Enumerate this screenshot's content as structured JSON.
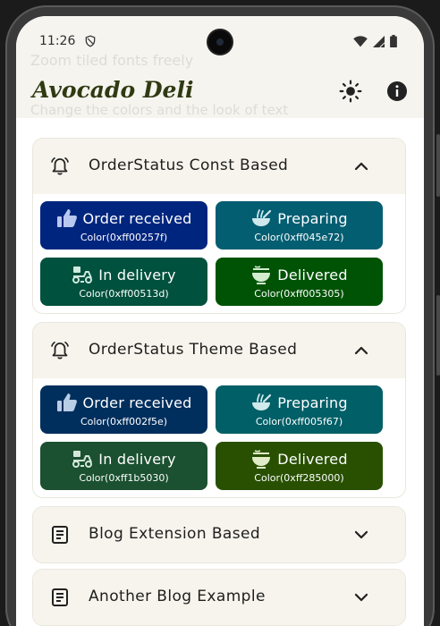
{
  "status_bar": {
    "time": "11:26"
  },
  "app_bar": {
    "title": "Avocado Deli",
    "ghost_line_1": "Zoom tiled fonts freely",
    "ghost_line_2": "Change the colors and the look of text"
  },
  "sections": [
    {
      "title": "OrderStatus Const Based",
      "expanded": true,
      "items": [
        {
          "label": "Order received",
          "code": "Color(0xff00257f)",
          "color": "#00257f",
          "icon": "thumbs-up-icon"
        },
        {
          "label": "Preparing",
          "code": "Color(0xff045e72)",
          "color": "#045e72",
          "icon": "soup-spoon-icon"
        },
        {
          "label": "In delivery",
          "code": "Color(0xff00513d)",
          "color": "#00513d",
          "icon": "delivery-scooter-icon"
        },
        {
          "label": "Delivered",
          "code": "Color(0xff005305)",
          "color": "#005305",
          "icon": "ramen-bowl-icon"
        }
      ]
    },
    {
      "title": "OrderStatus Theme Based",
      "expanded": true,
      "items": [
        {
          "label": "Order received",
          "code": "Color(0xff002f5e)",
          "color": "#002f5e",
          "icon": "thumbs-up-icon"
        },
        {
          "label": "Preparing",
          "code": "Color(0xff005f67)",
          "color": "#005f67",
          "icon": "soup-spoon-icon"
        },
        {
          "label": "In delivery",
          "code": "Color(0xff1b5030)",
          "color": "#1b5030",
          "icon": "delivery-scooter-icon"
        },
        {
          "label": "Delivered",
          "code": "Color(0xff285000)",
          "color": "#285000",
          "icon": "ramen-bowl-icon"
        }
      ]
    },
    {
      "title": "Blog Extension Based",
      "expanded": false
    },
    {
      "title": "Another Blog Example",
      "expanded": false
    }
  ],
  "colors": {
    "app_background": "#f6f4ef",
    "card_header": "#f6f4ec",
    "title_text": "#2f3a12",
    "label_text": "#ffffff"
  }
}
